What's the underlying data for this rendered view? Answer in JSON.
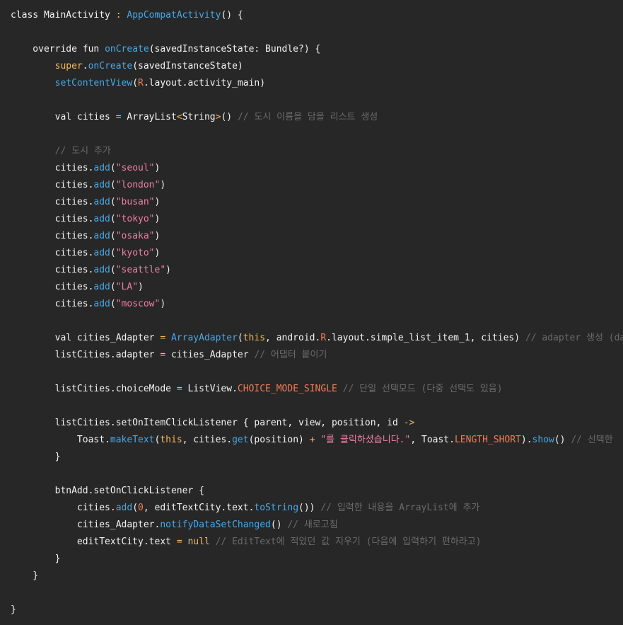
{
  "editor": {
    "language": "kotlin",
    "lines": [
      [
        {
          "t": "class MainActivity ",
          "c": "kw"
        },
        {
          "t": ": ",
          "c": "op"
        },
        {
          "t": "AppCompatActivity",
          "c": "fn"
        },
        {
          "t": "() {",
          "c": "kw"
        }
      ],
      [],
      [
        {
          "t": "    override fun ",
          "c": "kw"
        },
        {
          "t": "onCreate",
          "c": "fn"
        },
        {
          "t": "(savedInstanceState: Bundle?) {",
          "c": "kw"
        }
      ],
      [
        {
          "t": "        ",
          "c": "kw"
        },
        {
          "t": "super",
          "c": "ann"
        },
        {
          "t": ".",
          "c": "kw"
        },
        {
          "t": "onCreate",
          "c": "fn"
        },
        {
          "t": "(savedInstanceState)",
          "c": "kw"
        }
      ],
      [
        {
          "t": "        ",
          "c": "kw"
        },
        {
          "t": "setContentView",
          "c": "fn"
        },
        {
          "t": "(",
          "c": "kw"
        },
        {
          "t": "R",
          "c": "const"
        },
        {
          "t": ".layout.activity_main)",
          "c": "kw"
        }
      ],
      [],
      [
        {
          "t": "        val cities ",
          "c": "kw"
        },
        {
          "t": "= ",
          "c": "op"
        },
        {
          "t": "ArrayList",
          "c": "kw"
        },
        {
          "t": "<",
          "c": "op"
        },
        {
          "t": "String",
          "c": "kw"
        },
        {
          "t": ">",
          "c": "op"
        },
        {
          "t": "() ",
          "c": "kw"
        },
        {
          "t": "// 도시 이름을 담을 리스트 생성",
          "c": "cmt"
        }
      ],
      [],
      [
        {
          "t": "        ",
          "c": "kw"
        },
        {
          "t": "// 도시 추가",
          "c": "cmt"
        }
      ],
      [
        {
          "t": "        cities.",
          "c": "kw"
        },
        {
          "t": "add",
          "c": "fn"
        },
        {
          "t": "(",
          "c": "kw"
        },
        {
          "t": "\"seoul\"",
          "c": "str"
        },
        {
          "t": ")",
          "c": "kw"
        }
      ],
      [
        {
          "t": "        cities.",
          "c": "kw"
        },
        {
          "t": "add",
          "c": "fn"
        },
        {
          "t": "(",
          "c": "kw"
        },
        {
          "t": "\"london\"",
          "c": "str"
        },
        {
          "t": ")",
          "c": "kw"
        }
      ],
      [
        {
          "t": "        cities.",
          "c": "kw"
        },
        {
          "t": "add",
          "c": "fn"
        },
        {
          "t": "(",
          "c": "kw"
        },
        {
          "t": "\"busan\"",
          "c": "str"
        },
        {
          "t": ")",
          "c": "kw"
        }
      ],
      [
        {
          "t": "        cities.",
          "c": "kw"
        },
        {
          "t": "add",
          "c": "fn"
        },
        {
          "t": "(",
          "c": "kw"
        },
        {
          "t": "\"tokyo\"",
          "c": "str"
        },
        {
          "t": ")",
          "c": "kw"
        }
      ],
      [
        {
          "t": "        cities.",
          "c": "kw"
        },
        {
          "t": "add",
          "c": "fn"
        },
        {
          "t": "(",
          "c": "kw"
        },
        {
          "t": "\"osaka\"",
          "c": "str"
        },
        {
          "t": ")",
          "c": "kw"
        }
      ],
      [
        {
          "t": "        cities.",
          "c": "kw"
        },
        {
          "t": "add",
          "c": "fn"
        },
        {
          "t": "(",
          "c": "kw"
        },
        {
          "t": "\"kyoto\"",
          "c": "str"
        },
        {
          "t": ")",
          "c": "kw"
        }
      ],
      [
        {
          "t": "        cities.",
          "c": "kw"
        },
        {
          "t": "add",
          "c": "fn"
        },
        {
          "t": "(",
          "c": "kw"
        },
        {
          "t": "\"seattle\"",
          "c": "str"
        },
        {
          "t": ")",
          "c": "kw"
        }
      ],
      [
        {
          "t": "        cities.",
          "c": "kw"
        },
        {
          "t": "add",
          "c": "fn"
        },
        {
          "t": "(",
          "c": "kw"
        },
        {
          "t": "\"LA\"",
          "c": "str"
        },
        {
          "t": ")",
          "c": "kw"
        }
      ],
      [
        {
          "t": "        cities.",
          "c": "kw"
        },
        {
          "t": "add",
          "c": "fn"
        },
        {
          "t": "(",
          "c": "kw"
        },
        {
          "t": "\"moscow\"",
          "c": "str"
        },
        {
          "t": ")",
          "c": "kw"
        }
      ],
      [],
      [
        {
          "t": "        val cities_Adapter ",
          "c": "kw"
        },
        {
          "t": "= ",
          "c": "op"
        },
        {
          "t": "ArrayAdapter",
          "c": "fn"
        },
        {
          "t": "(",
          "c": "kw"
        },
        {
          "t": "this",
          "c": "ann"
        },
        {
          "t": ", android.",
          "c": "kw"
        },
        {
          "t": "R",
          "c": "const"
        },
        {
          "t": ".layout.simple_list_item_1, cities) ",
          "c": "kw"
        },
        {
          "t": "// adapter 생성 (da",
          "c": "cmt"
        }
      ],
      [
        {
          "t": "        listCities.adapter ",
          "c": "kw"
        },
        {
          "t": "= ",
          "c": "op"
        },
        {
          "t": "cities_Adapter ",
          "c": "kw"
        },
        {
          "t": "// 어댑터 붙이기",
          "c": "cmt"
        }
      ],
      [],
      [
        {
          "t": "        listCities.choiceMode ",
          "c": "kw"
        },
        {
          "t": "= ",
          "c": "op"
        },
        {
          "t": "ListView.",
          "c": "kw"
        },
        {
          "t": "CHOICE_MODE_SINGLE ",
          "c": "const"
        },
        {
          "t": "// 단일 선택모드 (다중 선택도 있음)",
          "c": "cmt"
        }
      ],
      [],
      [
        {
          "t": "        listCities.setOnItemClickListener { parent, view, position, id ",
          "c": "kw"
        },
        {
          "t": "->",
          "c": "op"
        }
      ],
      [
        {
          "t": "            Toast.",
          "c": "kw"
        },
        {
          "t": "makeText",
          "c": "fn"
        },
        {
          "t": "(",
          "c": "kw"
        },
        {
          "t": "this",
          "c": "ann"
        },
        {
          "t": ", cities.",
          "c": "kw"
        },
        {
          "t": "get",
          "c": "fn"
        },
        {
          "t": "(position) ",
          "c": "kw"
        },
        {
          "t": "+ ",
          "c": "op"
        },
        {
          "t": "\"를 클릭하셨습니다.\"",
          "c": "str"
        },
        {
          "t": ", Toast.",
          "c": "kw"
        },
        {
          "t": "LENGTH_SHORT",
          "c": "const"
        },
        {
          "t": ").",
          "c": "kw"
        },
        {
          "t": "show",
          "c": "fn"
        },
        {
          "t": "() ",
          "c": "kw"
        },
        {
          "t": "// 선택한",
          "c": "cmt"
        }
      ],
      [
        {
          "t": "        }",
          "c": "kw"
        }
      ],
      [],
      [
        {
          "t": "        btnAdd.setOnClickListener {",
          "c": "kw"
        }
      ],
      [
        {
          "t": "            cities.",
          "c": "kw"
        },
        {
          "t": "add",
          "c": "fn"
        },
        {
          "t": "(",
          "c": "kw"
        },
        {
          "t": "0",
          "c": "const"
        },
        {
          "t": ", editTextCity.text.",
          "c": "kw"
        },
        {
          "t": "toString",
          "c": "fn"
        },
        {
          "t": "()) ",
          "c": "kw"
        },
        {
          "t": "// 입력한 내용을 ArrayList에 추가",
          "c": "cmt"
        }
      ],
      [
        {
          "t": "            cities_Adapter.",
          "c": "kw"
        },
        {
          "t": "notifyDataSetChanged",
          "c": "fn"
        },
        {
          "t": "() ",
          "c": "kw"
        },
        {
          "t": "// 새로고침",
          "c": "cmt"
        }
      ],
      [
        {
          "t": "            editTextCity.text ",
          "c": "kw"
        },
        {
          "t": "= ",
          "c": "op"
        },
        {
          "t": "null ",
          "c": "ann"
        },
        {
          "t": "// EditText에 적었던 값 지우기 (다음에 입력하기 편하라고)",
          "c": "cmt"
        }
      ],
      [
        {
          "t": "        }",
          "c": "kw"
        }
      ],
      [
        {
          "t": "    }",
          "c": "kw"
        }
      ],
      [],
      [
        {
          "t": "}",
          "c": "kw"
        }
      ]
    ],
    "colors": {
      "background": "#272727",
      "keyword": "#f3f3f3",
      "function": "#48a8e6",
      "string": "#f27ea6",
      "comment": "#6a6a6a",
      "annotation": "#f3b95a",
      "constant": "#f07c55"
    }
  }
}
